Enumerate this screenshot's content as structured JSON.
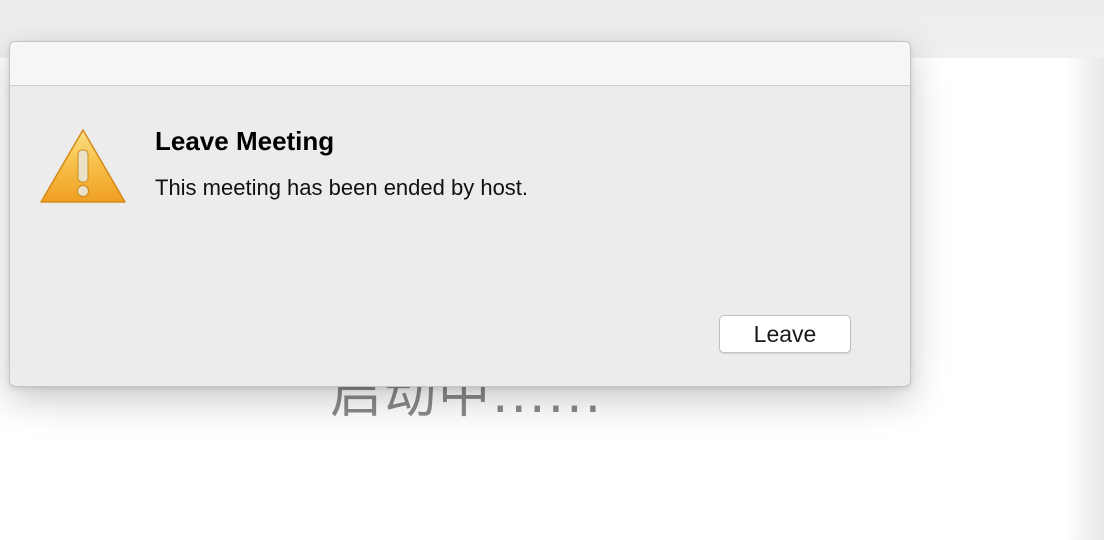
{
  "background": {
    "status_text": "启动中......"
  },
  "dialog": {
    "title": "Leave Meeting",
    "message": "This meeting has been ended by host.",
    "leave_button_label": "Leave",
    "icon": "warning-triangle-icon"
  },
  "colors": {
    "warning_fill_top": "#fcd66a",
    "warning_fill_bottom": "#f0a92a",
    "dialog_background": "#ececec"
  }
}
